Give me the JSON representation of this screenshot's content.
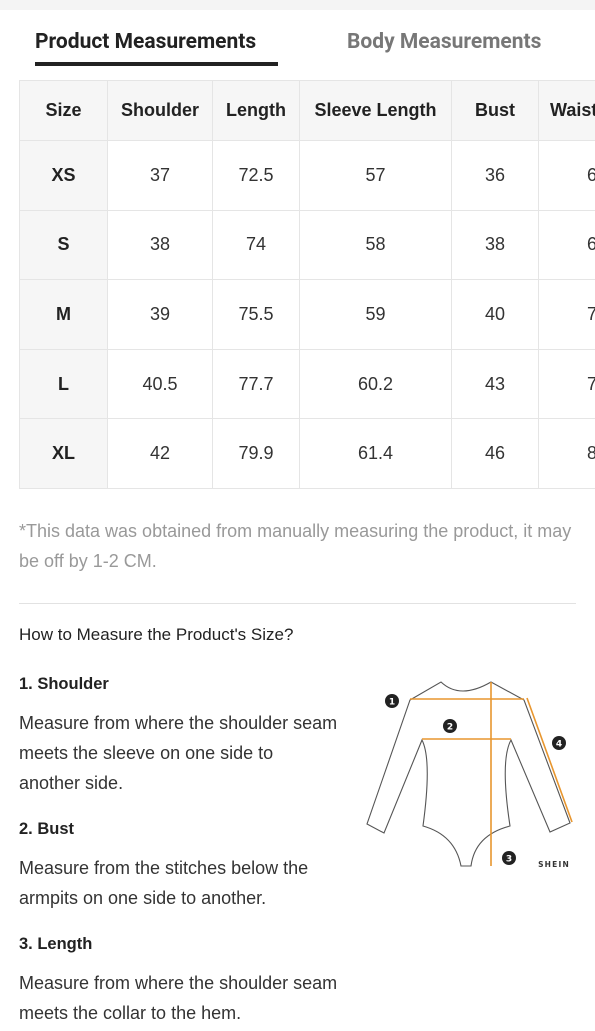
{
  "tabs": {
    "active": "Product Measurements",
    "inactive": "Body Measurements"
  },
  "table": {
    "headers": [
      "Size",
      "Shoulder",
      "Length",
      "Sleeve Length",
      "Bust",
      "Waist"
    ],
    "rows": [
      [
        "XS",
        "37",
        "72.5",
        "57",
        "36",
        "6"
      ],
      [
        "S",
        "38",
        "74",
        "58",
        "38",
        "6"
      ],
      [
        "M",
        "39",
        "75.5",
        "59",
        "40",
        "7"
      ],
      [
        "L",
        "40.5",
        "77.7",
        "60.2",
        "43",
        "7"
      ],
      [
        "XL",
        "42",
        "79.9",
        "61.4",
        "46",
        "8"
      ]
    ]
  },
  "note": "*This data was obtained from manually measuring the product, it may be off by 1-2 CM.",
  "how_to": {
    "title": "How to Measure the Product's Size?",
    "sections": [
      {
        "heading": "1. Shoulder",
        "text": "Measure from where the shoulder seam meets the sleeve on one side to another side."
      },
      {
        "heading": "2. Bust",
        "text": "Measure from the stitches below the armpits on one side to another."
      },
      {
        "heading": "3. Length",
        "text": "Measure from where the shoulder seam meets the collar to the hem."
      }
    ]
  },
  "diagram": {
    "markers": [
      "1",
      "2",
      "3",
      "4"
    ],
    "brand": "SHEIN",
    "line_color": "#e8962e"
  }
}
